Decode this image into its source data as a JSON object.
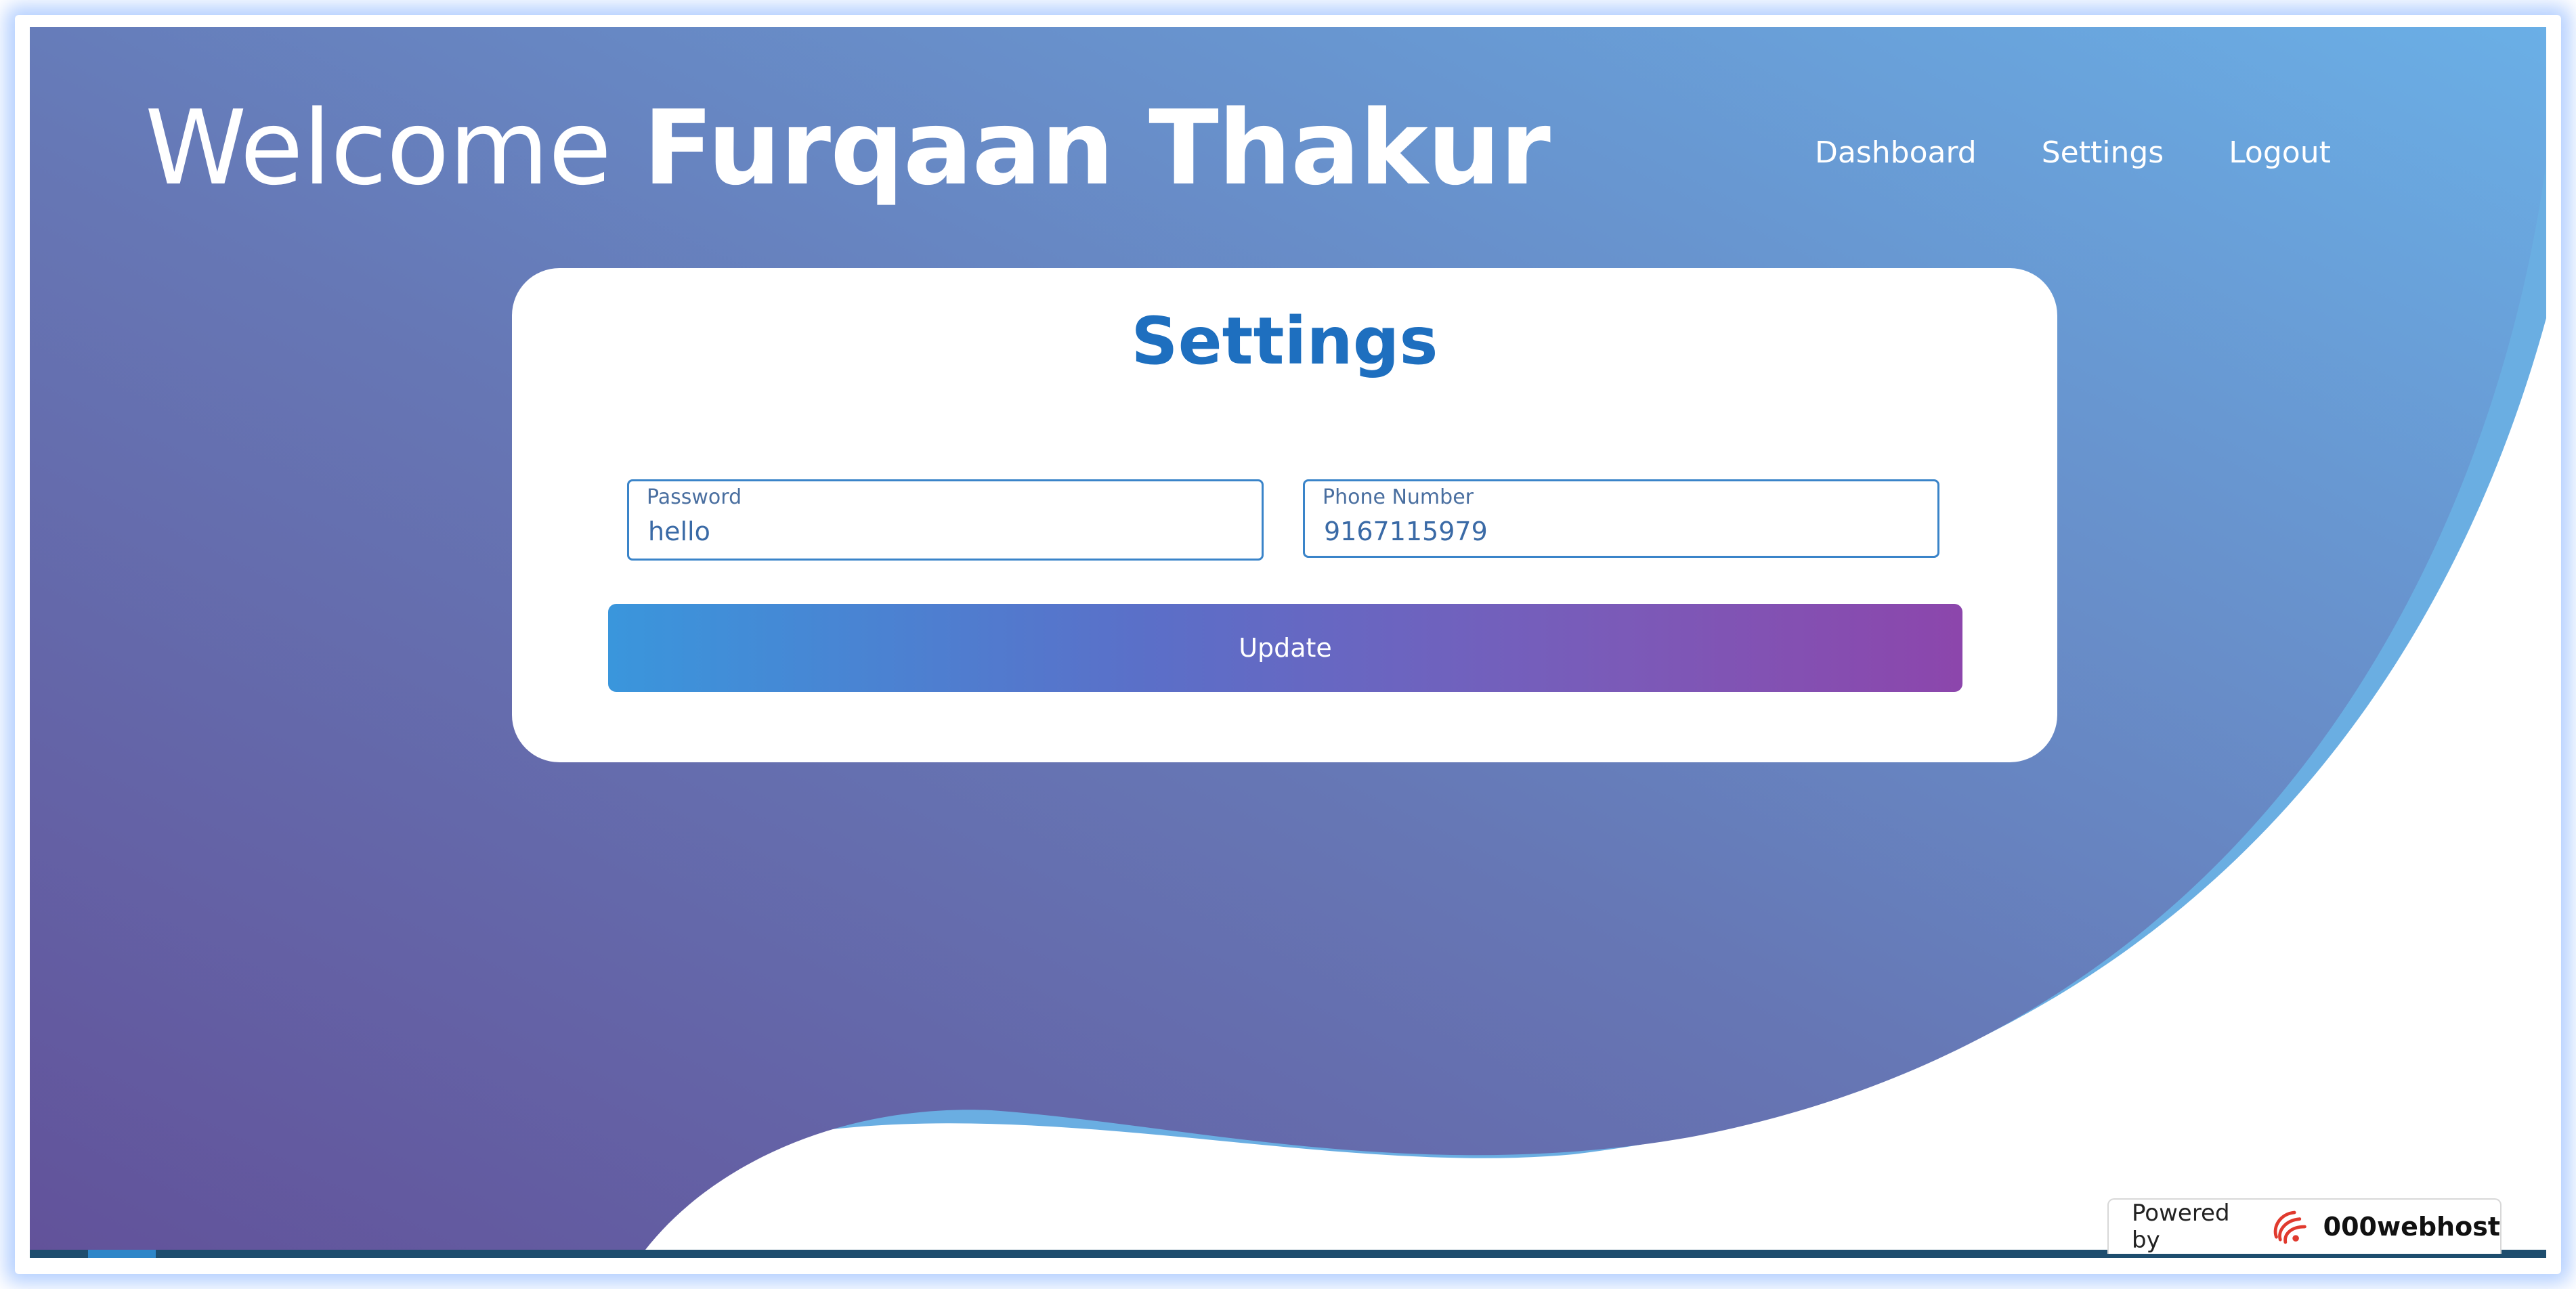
{
  "header": {
    "welcome_word": "Welcome",
    "user_name": "Furqaan Thakur"
  },
  "nav": {
    "items": [
      {
        "label": "Dashboard"
      },
      {
        "label": "Settings"
      },
      {
        "label": "Logout"
      }
    ]
  },
  "settings_card": {
    "title": "Settings",
    "password_field": {
      "label": "Password",
      "value": "hello"
    },
    "phone_field": {
      "label": "Phone Number",
      "value": "9167115979"
    },
    "update_button": "Update"
  },
  "footer_badge": {
    "powered_by": "Powered by",
    "brand": "000webhost",
    "logo_icon": "000webhost-logo-icon"
  },
  "colors": {
    "gradient_start": "#66569e",
    "gradient_end": "#68ade3",
    "accent_title": "#1e6fbf",
    "field_border": "#3a84c9"
  }
}
